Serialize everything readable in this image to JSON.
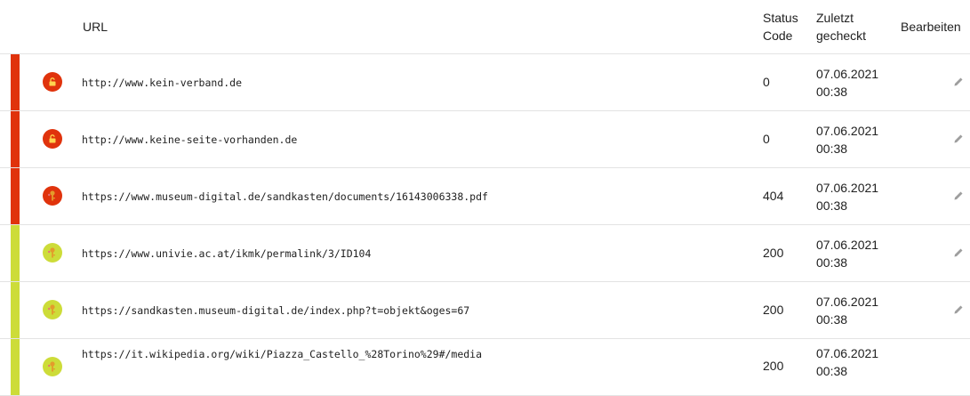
{
  "colors": {
    "error": "#e0330c",
    "ok": "#cddc39",
    "icon_error": "#e0330c",
    "icon_ok": "#cddc39",
    "key_color": "#e39b2b"
  },
  "header": {
    "url": "URL",
    "status": "Status Code",
    "checked": "Zuletzt gecheckt",
    "edit": "Bearbeiten"
  },
  "rows": [
    {
      "status_type": "error",
      "icon": "lock-icon",
      "url": "http://www.kein-verband.de",
      "code": "0",
      "date": "07.06.2021",
      "time": "00:38"
    },
    {
      "status_type": "error",
      "icon": "lock-icon",
      "url": "http://www.keine-seite-vorhanden.de",
      "code": "0",
      "date": "07.06.2021",
      "time": "00:38"
    },
    {
      "status_type": "error",
      "icon": "key-icon",
      "url": "https://www.museum-digital.de/sandkasten/documents/16143006338.pdf",
      "code": "404",
      "date": "07.06.2021",
      "time": "00:38"
    },
    {
      "status_type": "ok",
      "icon": "key-icon",
      "url": "https://www.univie.ac.at/ikmk/permalink/3/ID104",
      "code": "200",
      "date": "07.06.2021",
      "time": "00:38"
    },
    {
      "status_type": "ok",
      "icon": "key-icon",
      "url": "https://sandkasten.museum-digital.de/index.php?t=objekt&oges=67",
      "code": "200",
      "date": "07.06.2021",
      "time": "00:38"
    },
    {
      "status_type": "ok",
      "icon": "key-icon",
      "url": "https://it.wikipedia.org/wiki/Piazza_Castello_%28Torino%29#/media",
      "code": "200",
      "date": "07.06.2021",
      "time": "00:38"
    }
  ]
}
